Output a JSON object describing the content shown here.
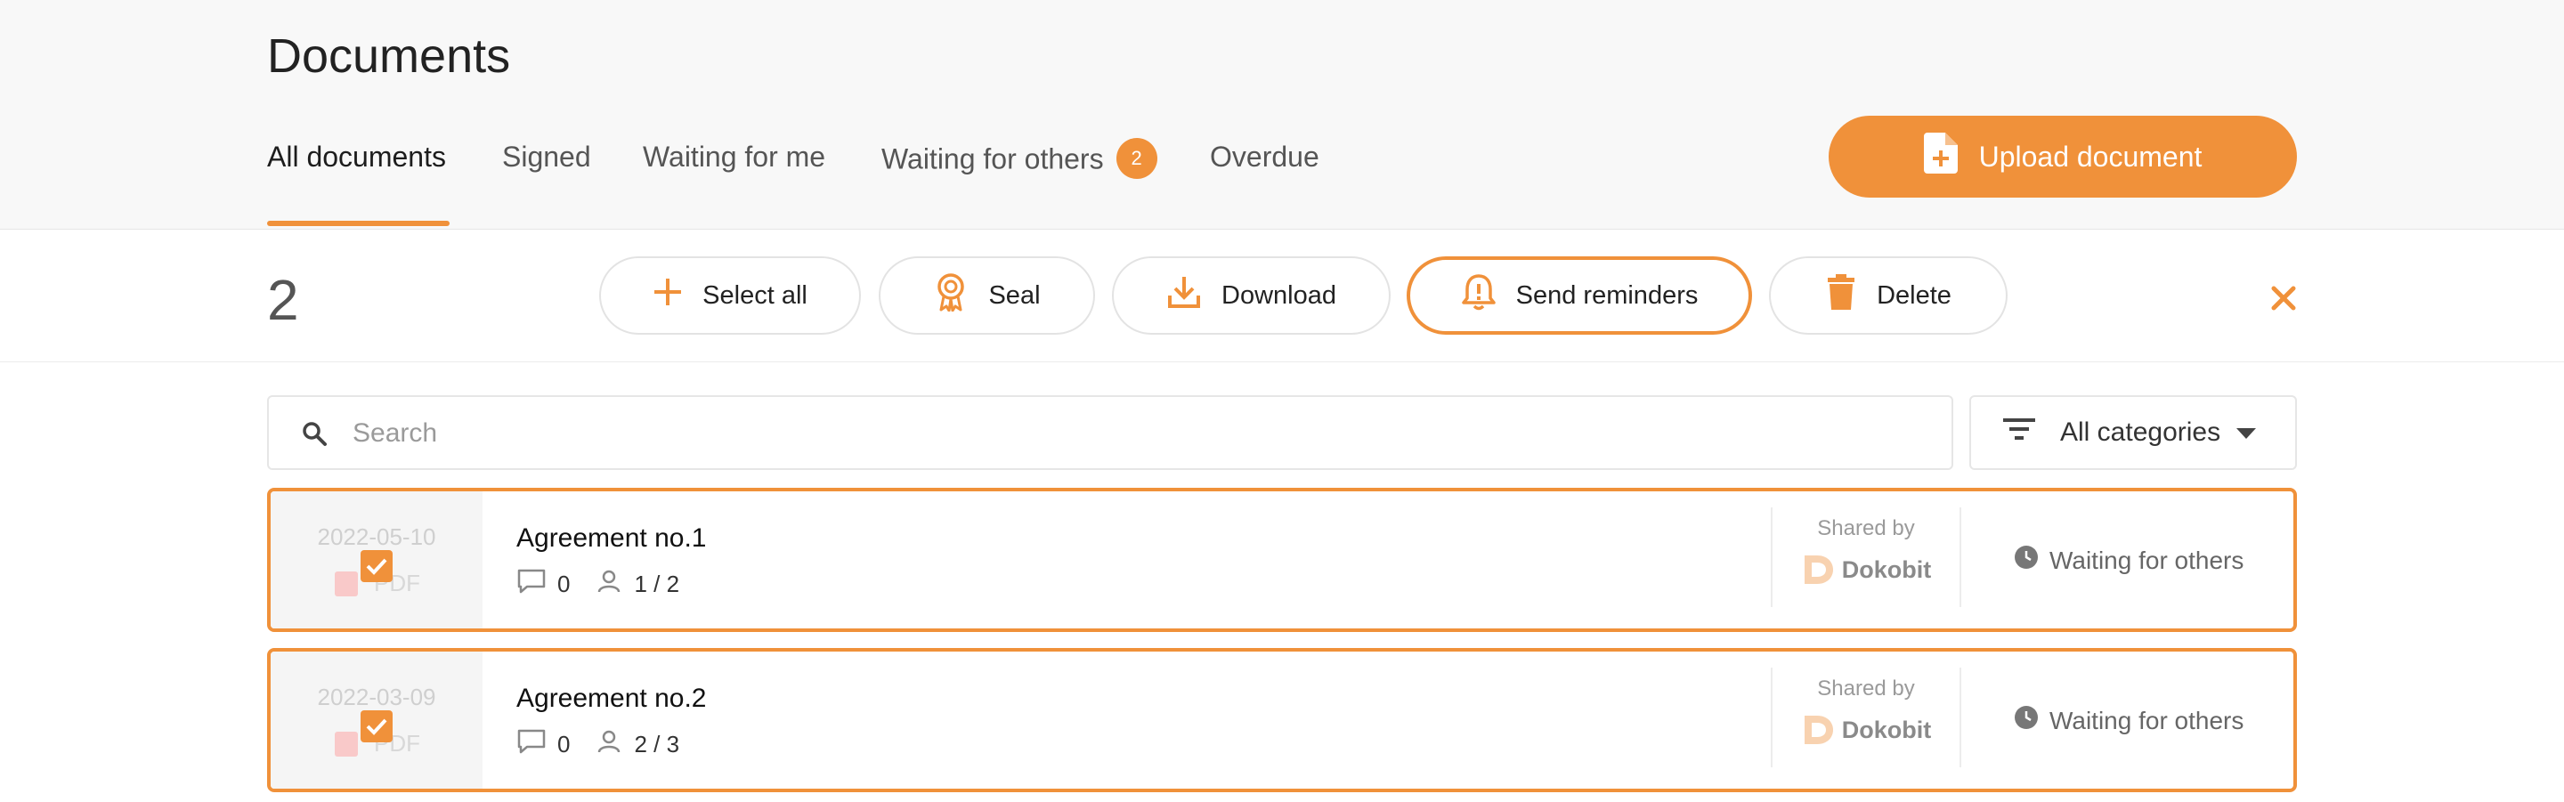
{
  "page": {
    "title": "Documents"
  },
  "tabs": [
    {
      "label": "All documents",
      "active": true
    },
    {
      "label": "Signed"
    },
    {
      "label": "Waiting for me"
    },
    {
      "label": "Waiting for others",
      "badge": "2"
    },
    {
      "label": "Overdue"
    }
  ],
  "upload": {
    "label": "Upload document",
    "icon": "document-plus-icon"
  },
  "actionbar": {
    "selected_count": "2",
    "buttons": [
      {
        "label": "Select all",
        "icon": "plus-icon"
      },
      {
        "label": "Seal",
        "icon": "seal-icon"
      },
      {
        "label": "Download",
        "icon": "download-icon"
      },
      {
        "label": "Send reminders",
        "icon": "bell-icon"
      },
      {
        "label": "Delete",
        "icon": "trash-icon"
      }
    ],
    "close_icon": "close-icon"
  },
  "search": {
    "placeholder": "Search",
    "value": ""
  },
  "filter": {
    "label": "All categories"
  },
  "documents": [
    {
      "date": "2022-05-10",
      "type": "PDF",
      "name": "Agreement no.1",
      "comments": "0",
      "signers": "1 / 2",
      "shared_by_label": "Shared by",
      "shared_by": "Dokobit",
      "status": "Waiting for others",
      "selected": true
    },
    {
      "date": "2022-03-09",
      "type": "PDF",
      "name": "Agreement no.2",
      "comments": "0",
      "signers": "2 / 3",
      "shared_by_label": "Shared by",
      "shared_by": "Dokobit",
      "status": "Waiting for others",
      "selected": true
    }
  ],
  "colors": {
    "accent": "#f0913a",
    "background_header": "#f8f8f8",
    "border": "#e6e6e6"
  }
}
